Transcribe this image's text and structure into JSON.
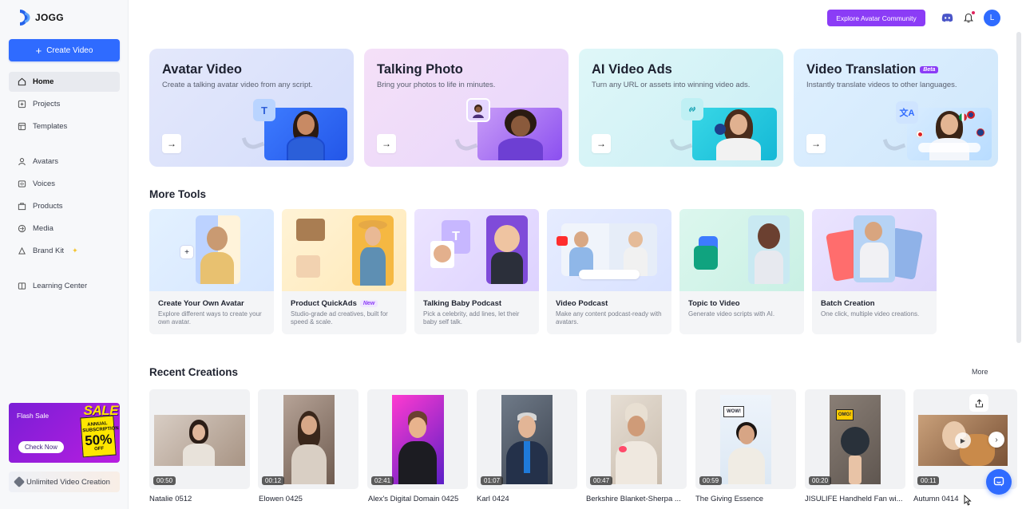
{
  "app": {
    "logo_text": "JOGG"
  },
  "sidebar": {
    "create_label": "Create Video",
    "items": [
      {
        "label": "Home",
        "icon": "home-icon"
      },
      {
        "label": "Projects",
        "icon": "projects-icon"
      },
      {
        "label": "Templates",
        "icon": "templates-icon"
      },
      {
        "label": "Avatars",
        "icon": "avatar-icon"
      },
      {
        "label": "Voices",
        "icon": "voice-icon"
      },
      {
        "label": "Products",
        "icon": "products-icon"
      },
      {
        "label": "Media",
        "icon": "media-icon"
      },
      {
        "label": "Brand Kit",
        "icon": "brand-kit-icon"
      },
      {
        "label": "Learning Center",
        "icon": "learning-center-icon"
      }
    ],
    "sale": {
      "label": "Flash Sale",
      "button": "Check Now",
      "word": "SALE",
      "badge_top": "ANNUAL SUBSCRIPTION",
      "badge_pct": "50%",
      "badge_bottom": "OFF"
    },
    "unlimited_label": "Unlimited Video Creation"
  },
  "header": {
    "explore_label": "Explore Avatar Community",
    "avatar_initial": "L"
  },
  "features": [
    {
      "title": "Avatar Video",
      "subtitle": "Create a talking avatar video from any script.",
      "chip": "T",
      "color": "#dde4fb"
    },
    {
      "title": "Talking Photo",
      "subtitle": "Bring your photos to life in minutes.",
      "color": "#f1dcf6"
    },
    {
      "title": "AI Video Ads",
      "subtitle": "Turn any URL or assets into winning video ads.",
      "color": "#d8f4f6"
    },
    {
      "title": "Video Translation",
      "badge": "Beta",
      "subtitle": "Instantly translate videos to other languages.",
      "color": "#dcefff"
    }
  ],
  "more_tools": {
    "title": "More Tools",
    "items": [
      {
        "name": "Create Your Own Avatar",
        "desc": "Explore different ways to create your own avatar."
      },
      {
        "name": "Product QuickAds",
        "tag": "New",
        "desc": "Studio-grade ad creatives, built for speed & scale."
      },
      {
        "name": "Talking Baby Podcast",
        "desc": "Pick a celebrity, add lines, let their baby self talk."
      },
      {
        "name": "Video Podcast",
        "desc": "Make any content podcast-ready with avatars."
      },
      {
        "name": "Topic to Video",
        "desc": "Generate video scripts with AI."
      },
      {
        "name": "Batch Creation",
        "desc": "One click, multiple video creations."
      }
    ]
  },
  "recent": {
    "title": "Recent Creations",
    "more_label": "More",
    "items": [
      {
        "name": "Natalie 0512",
        "duration": "00:50"
      },
      {
        "name": "Elowen 0425",
        "duration": "00:12"
      },
      {
        "name": "Alex's Digital Domain 0425",
        "duration": "02:41"
      },
      {
        "name": "Karl 0424",
        "duration": "01:07"
      },
      {
        "name": "Berkshire Blanket-Sherpa ...",
        "duration": "00:47"
      },
      {
        "name": "The Giving Essence",
        "duration": "00:59"
      },
      {
        "name": "JISULIFE Handheld Fan wi...",
        "duration": "00:20"
      },
      {
        "name": "Autumn 0414",
        "duration": "00:11"
      }
    ]
  }
}
